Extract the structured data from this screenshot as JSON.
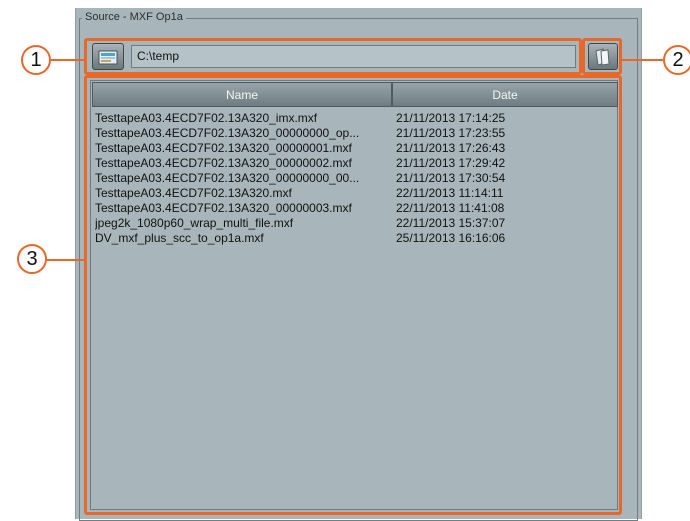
{
  "group": {
    "title": "Source - MXF Op1a"
  },
  "source": {
    "path": "C:\\temp",
    "browse_icon": "folder-browse-icon",
    "copy_icon": "copy-files-icon"
  },
  "list": {
    "columns": [
      "Name",
      "Date"
    ],
    "rows": [
      {
        "name": "TesttapeA03.4ECD7F02.13A320_imx.mxf",
        "date": "21/11/2013 17:14:25"
      },
      {
        "name": "TesttapeA03.4ECD7F02.13A320_00000000_op...",
        "date": "21/11/2013 17:23:55"
      },
      {
        "name": "TesttapeA03.4ECD7F02.13A320_00000001.mxf",
        "date": "21/11/2013 17:26:43"
      },
      {
        "name": "TesttapeA03.4ECD7F02.13A320_00000002.mxf",
        "date": "21/11/2013 17:29:42"
      },
      {
        "name": "TesttapeA03.4ECD7F02.13A320_00000000_00...",
        "date": "21/11/2013 17:30:54"
      },
      {
        "name": "TesttapeA03.4ECD7F02.13A320.mxf",
        "date": "22/11/2013 11:14:11"
      },
      {
        "name": "TesttapeA03.4ECD7F02.13A320_00000003.mxf",
        "date": "22/11/2013 11:41:08"
      },
      {
        "name": "jpeg2k_1080p60_wrap_multi_file.mxf",
        "date": "22/11/2013 15:37:07"
      },
      {
        "name": "DV_mxf_plus_scc_to_op1a.mxf",
        "date": "25/11/2013 16:16:06"
      }
    ]
  },
  "callouts": [
    "1",
    "2",
    "3"
  ],
  "colors": {
    "highlight": "#e8682a",
    "panel": "#a8b6bb"
  }
}
